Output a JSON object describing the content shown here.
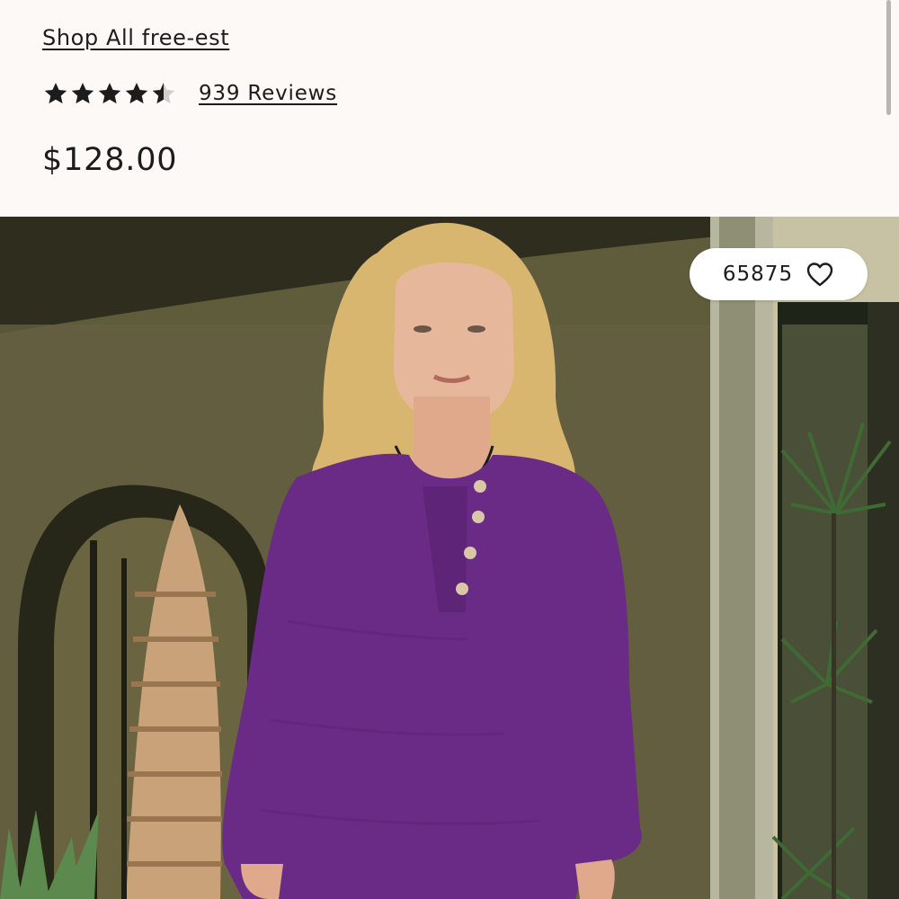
{
  "product": {
    "shop_link": "Shop All free-est",
    "rating": 4.5,
    "rating_max": 5,
    "reviews_label": "939 Reviews",
    "price": "$128.00"
  },
  "gallery": {
    "like_count": "65875",
    "like_icon": "heart-outline-icon"
  },
  "colors": {
    "text": "#1c1c1c",
    "background": "#fcf9f7",
    "star": "#1c1c1c",
    "star_empty": "#cfcfcf",
    "sweater": "#6a2b86"
  }
}
